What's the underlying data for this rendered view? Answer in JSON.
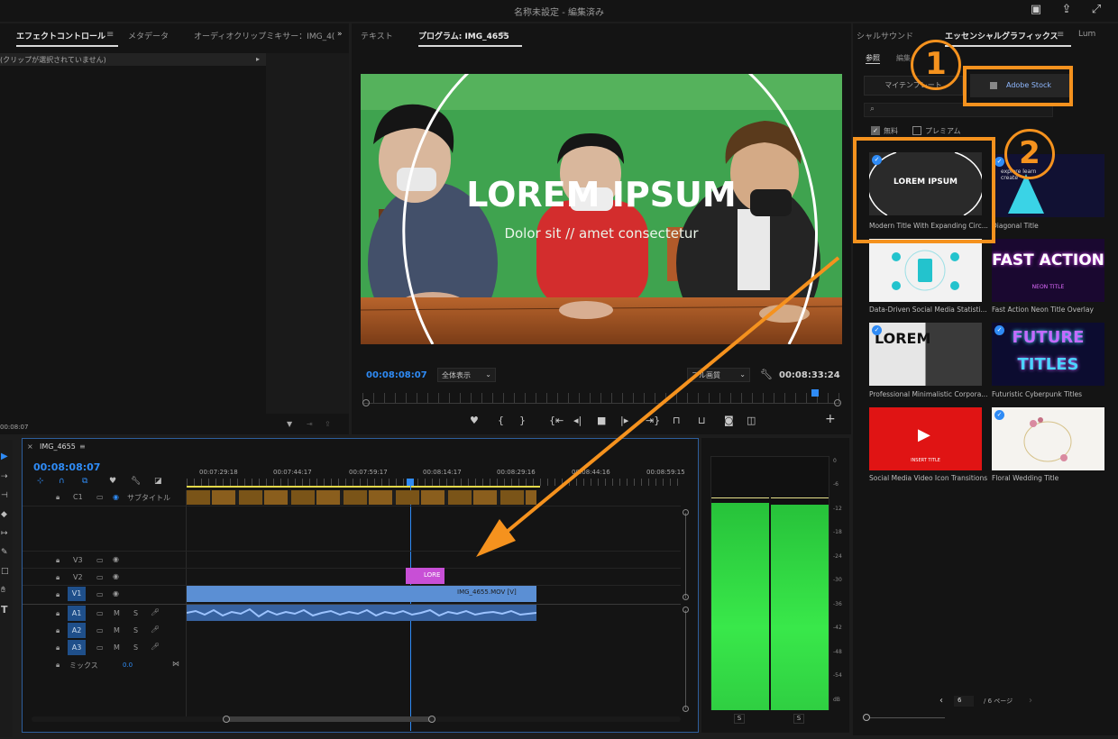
{
  "app": {
    "title": "名称未設定 - 編集済み"
  },
  "left_panel": {
    "tabs": [
      "エフェクトコントロール",
      "メタデータ",
      "オーディオクリップミキサー：IMG_4("
    ],
    "no_clip_text": "(クリップが選択されていません)",
    "timecode": "00:08:07"
  },
  "program_monitor": {
    "tabs": [
      "テキスト",
      "プログラム: IMG_4655"
    ],
    "title_text": "LOREM IPSUM",
    "subtitle_text": "Dolor sit // amet consectetur",
    "timecode_current": "00:08:08:07",
    "fit_label": "全体表示",
    "quality_label": "フル画質",
    "timecode_duration": "00:08:33:24"
  },
  "timeline": {
    "sequence_name": "IMG_4655",
    "timecode": "00:08:08:07",
    "ruler": [
      "00:07:29:18",
      "00:07:44:17",
      "00:07:59:17",
      "00:08:14:17",
      "00:08:29:16",
      "00:08:44:16",
      "00:08:59:15"
    ],
    "caption_track": "C1",
    "caption_track_label": "サブタイトル",
    "video_tracks": [
      "V3",
      "V2",
      "V1"
    ],
    "audio_tracks": [
      "A1",
      "A2",
      "A3"
    ],
    "track_m": "M",
    "track_s": "S",
    "mix_label": "ミックス",
    "mix_value": "0.0",
    "graphic_clip": "LORE",
    "video_clip": "IMG_4655.MOV [V]"
  },
  "audio_meter": {
    "scale": [
      "0",
      "-6",
      "-12",
      "-18",
      "-24",
      "-30",
      "-36",
      "-42",
      "-48",
      "-54",
      "dB"
    ],
    "solo_labels": [
      "S",
      "S"
    ],
    "levels": [
      0.82,
      0.81
    ]
  },
  "essential_graphics": {
    "tabs": [
      "シャルサウンド",
      "エッセンシャルグラフィックス",
      "Lum"
    ],
    "subtabs": [
      "参照",
      "編集"
    ],
    "my_templates": "マイテンプレート",
    "adobe_stock": "Adobe Stock",
    "search_icon": "search-icon",
    "filter_free": "無料",
    "filter_premium": "プレミアム",
    "templates": [
      {
        "name": "Modern Title With Expanding Circ...",
        "thumb_text": "LOREM IPSUM",
        "bg": "#2a2a2a"
      },
      {
        "name": "Diagonal Title",
        "thumb_text": "explore learn create",
        "bg": "#111133"
      },
      {
        "name": "Data-Driven Social Media Statisti...",
        "thumb_text": "",
        "bg": "#f2f2f2"
      },
      {
        "name": "Fast Action Neon Title Overlay",
        "thumb_text": "FAST ACTION",
        "thumb_sub": "NEON TITLE",
        "bg": "#1a0830"
      },
      {
        "name": "Professional Minimalistic Corpora...",
        "thumb_text": "LOREM",
        "bg": "#e6e6e6"
      },
      {
        "name": "Futuristic Cyberpunk Titles",
        "thumb_text": "FUTURE",
        "thumb_sub": "TITLES",
        "bg": "#0c0c30"
      },
      {
        "name": "Social Media Video Icon Transitions",
        "thumb_text": "INSERT TITLE",
        "bg": "#e01414"
      },
      {
        "name": "Floral Wedding Title",
        "thumb_text": "",
        "bg": "#f5f3ef"
      }
    ],
    "page_current": "6",
    "page_total": "/ 6 ページ"
  },
  "annotations": {
    "step1": "1",
    "step2": "2",
    "accent": "#f5921e"
  }
}
